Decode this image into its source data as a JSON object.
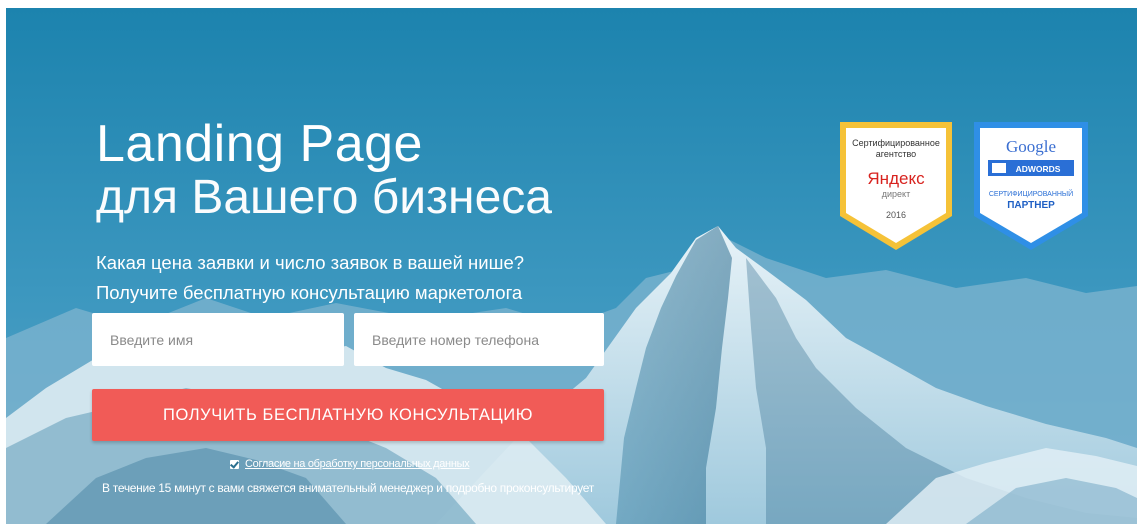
{
  "headline": {
    "line1": "Landing Page",
    "line2": "для Вашего бизнеса"
  },
  "subheadline": {
    "line1": "Какая цена заявки и число заявок в вашей нише?",
    "line2": "Получите бесплатную консультацию маркетолога"
  },
  "form": {
    "name_placeholder": "Введите имя",
    "name_value": "",
    "phone_placeholder": "Введите номер телефона",
    "phone_value": "",
    "submit_label": "ПОЛУЧИТЬ БЕСПЛАТНУЮ КОНСУЛЬТАЦИЮ",
    "consent_checked": true,
    "consent_label": "Согласие на обработку персональных данных",
    "note": "В течение 15 минут с вами свяжется внимательный менеджер и подробно проконсультирует"
  },
  "badges": {
    "yandex": {
      "top_line1": "Сертифицированное",
      "top_line2": "агентство",
      "logo": "Яндекс",
      "product": "директ",
      "year": "2016"
    },
    "google": {
      "logo": "Google",
      "product": "ADWORDS",
      "line1": "СЕРТИФИЦИРОВАННЫЙ",
      "line2": "ПАРТНЕР"
    }
  },
  "colors": {
    "cta": "#f15b57",
    "sky": "#1f86b0",
    "yandex_badge": "#f5c238",
    "google_badge": "#2f8fe6"
  }
}
